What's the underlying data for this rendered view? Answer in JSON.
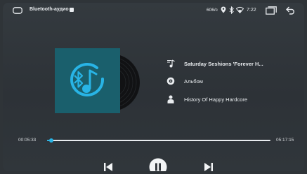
{
  "status_bar": {
    "source_label": "Bluetooth-аудио",
    "speed": "606/с",
    "time": "7:22"
  },
  "track": {
    "title": "Saturday Seshions 'Forever H...",
    "album": "Альбом",
    "artist": "History Of Happy Hardcore"
  },
  "playback": {
    "elapsed": "00:05:33",
    "total": "05:17:15",
    "progress_fraction": 0.018
  },
  "icons": {
    "home": "home-icon",
    "location": "location-icon",
    "bluetooth": "bluetooth-icon",
    "wifi": "wifi-icon",
    "recent": "recent-apps-icon",
    "back": "back-icon",
    "title": "music-note-icon",
    "album": "disc-icon",
    "artist": "person-icon",
    "prev": "skip-previous-icon",
    "play": "pause-icon",
    "next": "skip-next-icon"
  },
  "colors": {
    "accent": "#28b4e6",
    "cover_bg": "#1a5f6c",
    "background": "#2f3438",
    "text": "#e9ecef"
  }
}
